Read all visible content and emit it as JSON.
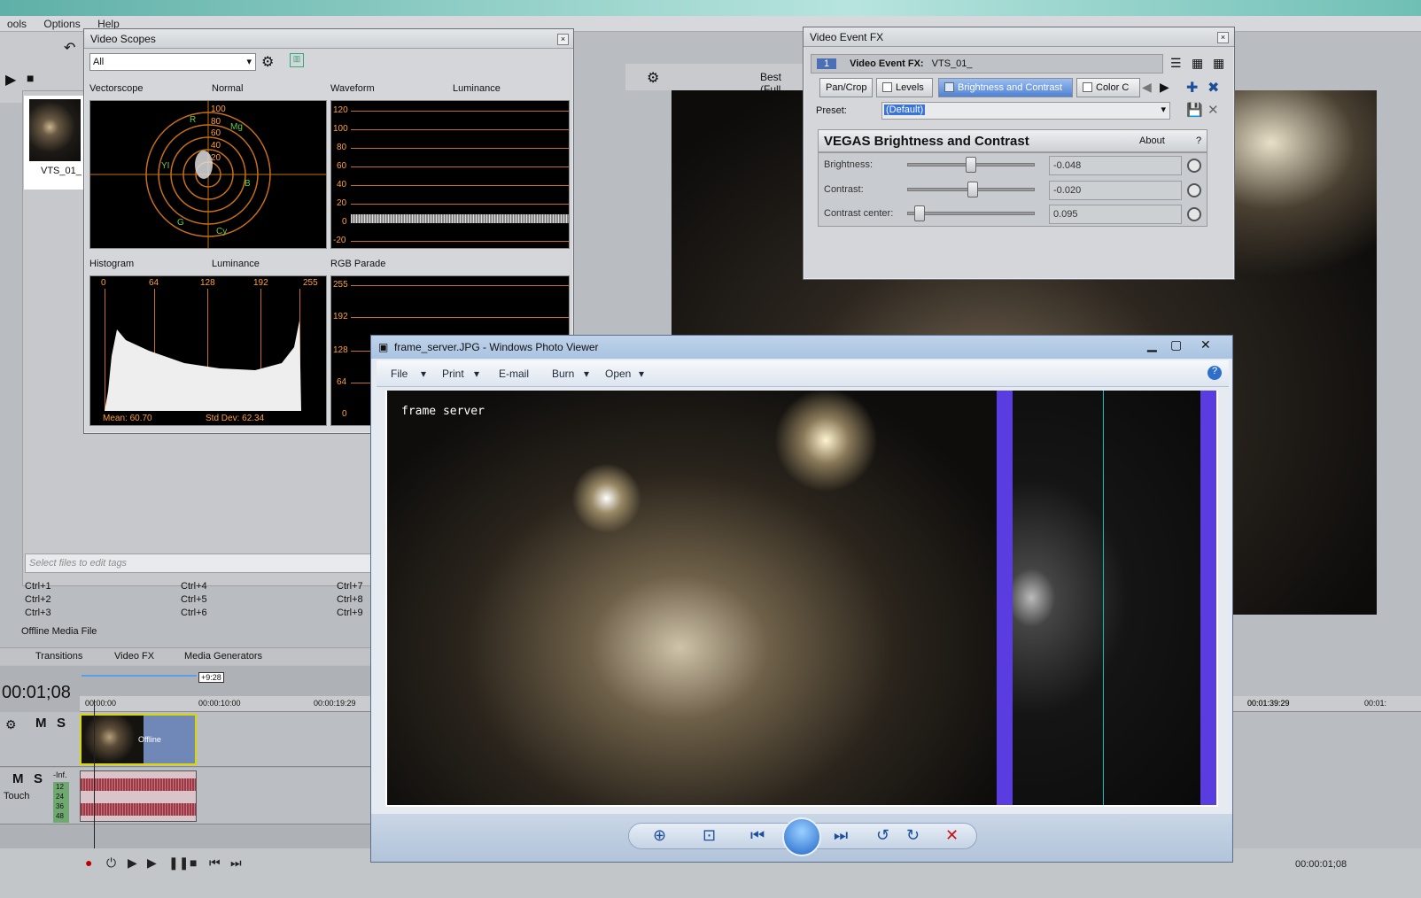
{
  "menubar": {
    "items": [
      "ools",
      "Options",
      "Help"
    ]
  },
  "explorer": {
    "thumb_label": "VTS_01_",
    "tags_placeholder": "Select files to edit tags",
    "shortcuts": [
      "Ctrl+1",
      "Ctrl+4",
      "Ctrl+7",
      "Ctrl+2",
      "Ctrl+5",
      "Ctrl+8",
      "Ctrl+3",
      "Ctrl+6",
      "Ctrl+9"
    ],
    "status": "Offline Media File",
    "tabs": [
      "Transitions",
      "Video FX",
      "Media Generators"
    ]
  },
  "timeline": {
    "timecode": "00:01;08",
    "region_len": "+9:28",
    "ruler": [
      "00:00:00",
      "00:00:10:00",
      "00:00:19:29",
      "00:01:39:29",
      "00:01:"
    ],
    "track1": {
      "mute": "M",
      "solo": "S",
      "clip_text": "Offline"
    },
    "track2": {
      "mute": "M",
      "solo": "S",
      "vol": "-Inf.",
      "mode": "Touch",
      "meter": [
        "12",
        "24",
        "36",
        "48"
      ]
    },
    "end_time": "00:00:01;08"
  },
  "preview_toolbar": {
    "quality": "Best (Full"
  },
  "video_scopes": {
    "title": "Video Scopes",
    "dropdown": "All",
    "vectorscope": {
      "label": "Vectorscope",
      "mode": "Normal",
      "rings": [
        "100",
        "80",
        "60",
        "40",
        "20"
      ],
      "targets": [
        "R",
        "Mg",
        "YI",
        "B",
        "G",
        "Cy"
      ]
    },
    "waveform": {
      "label": "Waveform",
      "mode": "Luminance",
      "y": [
        "120",
        "100",
        "80",
        "60",
        "40",
        "20",
        "0",
        "-20"
      ]
    },
    "histogram": {
      "label": "Histogram",
      "mode": "Luminance",
      "x": [
        "0",
        "64",
        "128",
        "192",
        "255"
      ],
      "mean": "Mean: 60.70",
      "stddev": "Std Dev: 62.34"
    },
    "rgb_parade": {
      "label": "RGB Parade",
      "y": [
        "255",
        "192",
        "128",
        "64",
        "0"
      ]
    }
  },
  "fx": {
    "title": "Video Event FX",
    "chain_num": "1",
    "header_label": "Video Event FX:",
    "header_value": "VTS_01_",
    "tabs": [
      "Pan/Crop",
      "Levels",
      "Brightness and Contrast",
      "Color C"
    ],
    "preset_label": "Preset:",
    "preset_value": "(Default)",
    "plugin_title": "VEGAS Brightness and Contrast",
    "about": "About",
    "help": "?",
    "params": [
      {
        "label": "Brightness:",
        "value": "-0.048",
        "pos": 0.476
      },
      {
        "label": "Contrast:",
        "value": "-0.020",
        "pos": 0.49
      },
      {
        "label": "Contrast center:",
        "value": "0.095",
        "pos": 0.095
      }
    ]
  },
  "photo_viewer": {
    "title": "frame_server.JPG - Windows Photo Viewer",
    "menu": [
      "File",
      "Print",
      "E-mail",
      "Burn",
      "Open"
    ],
    "overlay_text": "frame server"
  },
  "colors": {
    "accent": "#1c4f9a",
    "scope_orange": "#c76f16",
    "purple_bar": "#5a3de0",
    "selected": "#3a74d8"
  }
}
